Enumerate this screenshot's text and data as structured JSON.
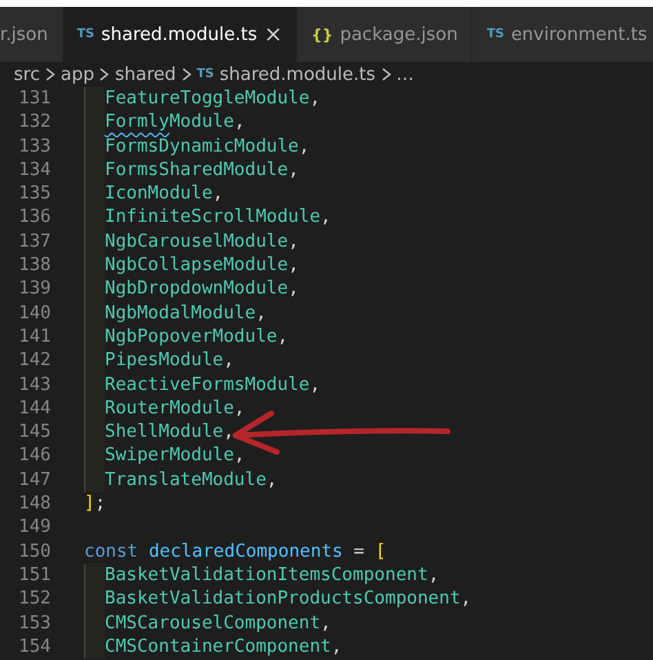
{
  "tabs": [
    {
      "label": "r.json",
      "selected": false
    },
    {
      "badge": "TS",
      "label": "shared.module.ts",
      "close": "×",
      "selected": true
    },
    {
      "badge": "{}",
      "label": "package.json",
      "selected": false
    },
    {
      "badge": "TS",
      "label": "environment.ts",
      "selected": false
    }
  ],
  "breadcrumb": [
    {
      "label": "src"
    },
    {
      "label": "app"
    },
    {
      "label": "shared"
    },
    {
      "badge": "TS",
      "label": "shared.module.ts"
    },
    {
      "label": "…"
    }
  ],
  "lines": [
    {
      "number": "131",
      "indented": true,
      "marked": false,
      "tokens": [
        {
          "text": "FeatureToggleModule",
          "kind": "type"
        },
        {
          "text": ",",
          "kind": "punct"
        }
      ]
    },
    {
      "number": "132",
      "indented": true,
      "marked": false,
      "tokens": [
        {
          "text": "Formly",
          "kind": "type",
          "squiggle": true
        },
        {
          "text": "Module",
          "kind": "type"
        },
        {
          "text": ",",
          "kind": "punct"
        }
      ]
    },
    {
      "number": "133",
      "indented": true,
      "marked": false,
      "tokens": [
        {
          "text": "FormsDynamicModule",
          "kind": "type"
        },
        {
          "text": ",",
          "kind": "punct"
        }
      ]
    },
    {
      "number": "134",
      "indented": true,
      "marked": false,
      "tokens": [
        {
          "text": "FormsSharedModule",
          "kind": "type"
        },
        {
          "text": ",",
          "kind": "punct"
        }
      ]
    },
    {
      "number": "135",
      "indented": true,
      "marked": false,
      "tokens": [
        {
          "text": "IconModule",
          "kind": "type"
        },
        {
          "text": ",",
          "kind": "punct"
        }
      ]
    },
    {
      "number": "136",
      "indented": true,
      "marked": false,
      "tokens": [
        {
          "text": "InfiniteScrollModule",
          "kind": "type"
        },
        {
          "text": ",",
          "kind": "punct"
        }
      ]
    },
    {
      "number": "137",
      "indented": true,
      "marked": false,
      "tokens": [
        {
          "text": "NgbCarouselModule",
          "kind": "type"
        },
        {
          "text": ",",
          "kind": "punct"
        }
      ]
    },
    {
      "number": "138",
      "indented": true,
      "marked": false,
      "tokens": [
        {
          "text": "NgbCollapseModule",
          "kind": "type"
        },
        {
          "text": ",",
          "kind": "punct"
        }
      ]
    },
    {
      "number": "139",
      "indented": true,
      "marked": false,
      "tokens": [
        {
          "text": "NgbDropdownModule",
          "kind": "type"
        },
        {
          "text": ",",
          "kind": "punct"
        }
      ]
    },
    {
      "number": "140",
      "indented": true,
      "marked": false,
      "tokens": [
        {
          "text": "NgbModalModule",
          "kind": "type"
        },
        {
          "text": ",",
          "kind": "punct"
        }
      ]
    },
    {
      "number": "141",
      "indented": true,
      "marked": false,
      "tokens": [
        {
          "text": "NgbPopoverModule",
          "kind": "type"
        },
        {
          "text": ",",
          "kind": "punct"
        }
      ]
    },
    {
      "number": "142",
      "indented": true,
      "marked": false,
      "tokens": [
        {
          "text": "PipesModule",
          "kind": "type"
        },
        {
          "text": ",",
          "kind": "punct"
        }
      ]
    },
    {
      "number": "143",
      "indented": true,
      "marked": false,
      "tokens": [
        {
          "text": "ReactiveFormsModule",
          "kind": "type"
        },
        {
          "text": ",",
          "kind": "punct"
        }
      ]
    },
    {
      "number": "144",
      "indented": true,
      "marked": false,
      "tokens": [
        {
          "text": "RouterModule",
          "kind": "type"
        },
        {
          "text": ",",
          "kind": "punct"
        }
      ]
    },
    {
      "number": "145",
      "indented": true,
      "marked": true,
      "tokens": [
        {
          "text": "ShellModule",
          "kind": "type"
        },
        {
          "text": ",",
          "kind": "punct"
        }
      ]
    },
    {
      "number": "146",
      "indented": true,
      "marked": false,
      "tokens": [
        {
          "text": "SwiperModule",
          "kind": "type"
        },
        {
          "text": ",",
          "kind": "punct"
        }
      ]
    },
    {
      "number": "147",
      "indented": true,
      "marked": false,
      "tokens": [
        {
          "text": "TranslateModule",
          "kind": "type"
        },
        {
          "text": ",",
          "kind": "punct"
        }
      ]
    },
    {
      "number": "148",
      "indented": false,
      "marked": false,
      "tokens": [
        {
          "text": "]",
          "kind": "bracket"
        },
        {
          "text": ";",
          "kind": "punct"
        }
      ]
    },
    {
      "number": "149"
    },
    {
      "number": "150",
      "indented": false,
      "marked": false,
      "tokens": [
        {
          "text": "const",
          "kind": "keyword"
        },
        {
          "text": "declaredComponents",
          "kind": "variable"
        },
        {
          "text": "=",
          "kind": "punct"
        },
        {
          "text": "[",
          "kind": "bracket"
        }
      ]
    },
    {
      "number": "151",
      "indented": true,
      "marked": false,
      "tokens": [
        {
          "text": "BasketValidationItemsComponent",
          "kind": "type"
        },
        {
          "text": ",",
          "kind": "punct"
        }
      ]
    },
    {
      "number": "152",
      "indented": true,
      "marked": false,
      "tokens": [
        {
          "text": "BasketValidationProductsComponent",
          "kind": "type"
        },
        {
          "text": ",",
          "kind": "punct"
        }
      ]
    },
    {
      "number": "153",
      "indented": true,
      "marked": false,
      "tokens": [
        {
          "text": "CMSCarouselComponent",
          "kind": "type"
        },
        {
          "text": ",",
          "kind": "punct"
        }
      ]
    },
    {
      "number": "154",
      "indented": true,
      "marked": false,
      "tokens": [
        {
          "text": "CMSContainerComponent",
          "kind": "type"
        },
        {
          "text": ",",
          "kind": "punct"
        }
      ]
    }
  ]
}
